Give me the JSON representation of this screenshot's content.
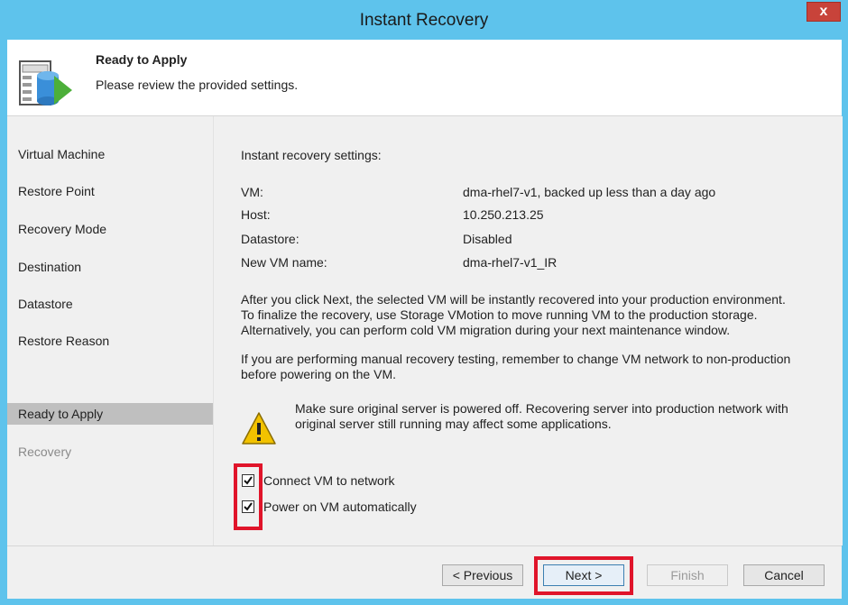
{
  "window": {
    "title": "Instant Recovery",
    "close_label": "x"
  },
  "header": {
    "title": "Ready to Apply",
    "subtitle": "Please review the provided  settings."
  },
  "sidebar": {
    "items": [
      {
        "label": "Virtual Machine",
        "state": "normal"
      },
      {
        "label": "Restore Point",
        "state": "normal"
      },
      {
        "label": "Recovery Mode",
        "state": "normal"
      },
      {
        "label": "Destination",
        "state": "normal"
      },
      {
        "label": "Datastore",
        "state": "normal"
      },
      {
        "label": "Restore Reason",
        "state": "normal"
      },
      {
        "label": "Ready to Apply",
        "state": "active"
      },
      {
        "label": "Recovery",
        "state": "disabled"
      }
    ]
  },
  "main": {
    "section_title": "Instant recovery settings:",
    "settings": [
      {
        "label": "VM:",
        "value": "dma-rhel7-v1, backed up less than a day ago"
      },
      {
        "label": "Host:",
        "value": "10.250.213.25"
      },
      {
        "label": "Datastore:",
        "value": "Disabled"
      },
      {
        "label": "New VM name:",
        "value": "dma-rhel7-v1_IR"
      }
    ],
    "para1": [
      "After you click Next, the selected VM will be instantly recovered into your production environment.",
      "To finalize the recovery, use Storage VMotion to move running VM to the production storage.",
      "Alternatively, you can perform cold VM migration during your next maintenance window."
    ],
    "para2": [
      "If you are performing manual recovery testing, remember to change VM network to non-production",
      "before powering on the VM."
    ],
    "warning": [
      "Make sure original server is powered off. Recovering server into production network with",
      "original server still running may affect some applications."
    ],
    "checkboxes": [
      {
        "label": "Connect VM to network",
        "checked": true
      },
      {
        "label": "Power on VM automatically",
        "checked": true
      }
    ]
  },
  "footer": {
    "previous_label": "< Previous",
    "next_label": "Next >",
    "finish_label": "Finish",
    "cancel_label": "Cancel"
  },
  "colors": {
    "titlebar": "#5ec3ec",
    "highlight": "#e0142a",
    "active_nav": "#bfbfbf",
    "panel": "#f0f0f0"
  }
}
